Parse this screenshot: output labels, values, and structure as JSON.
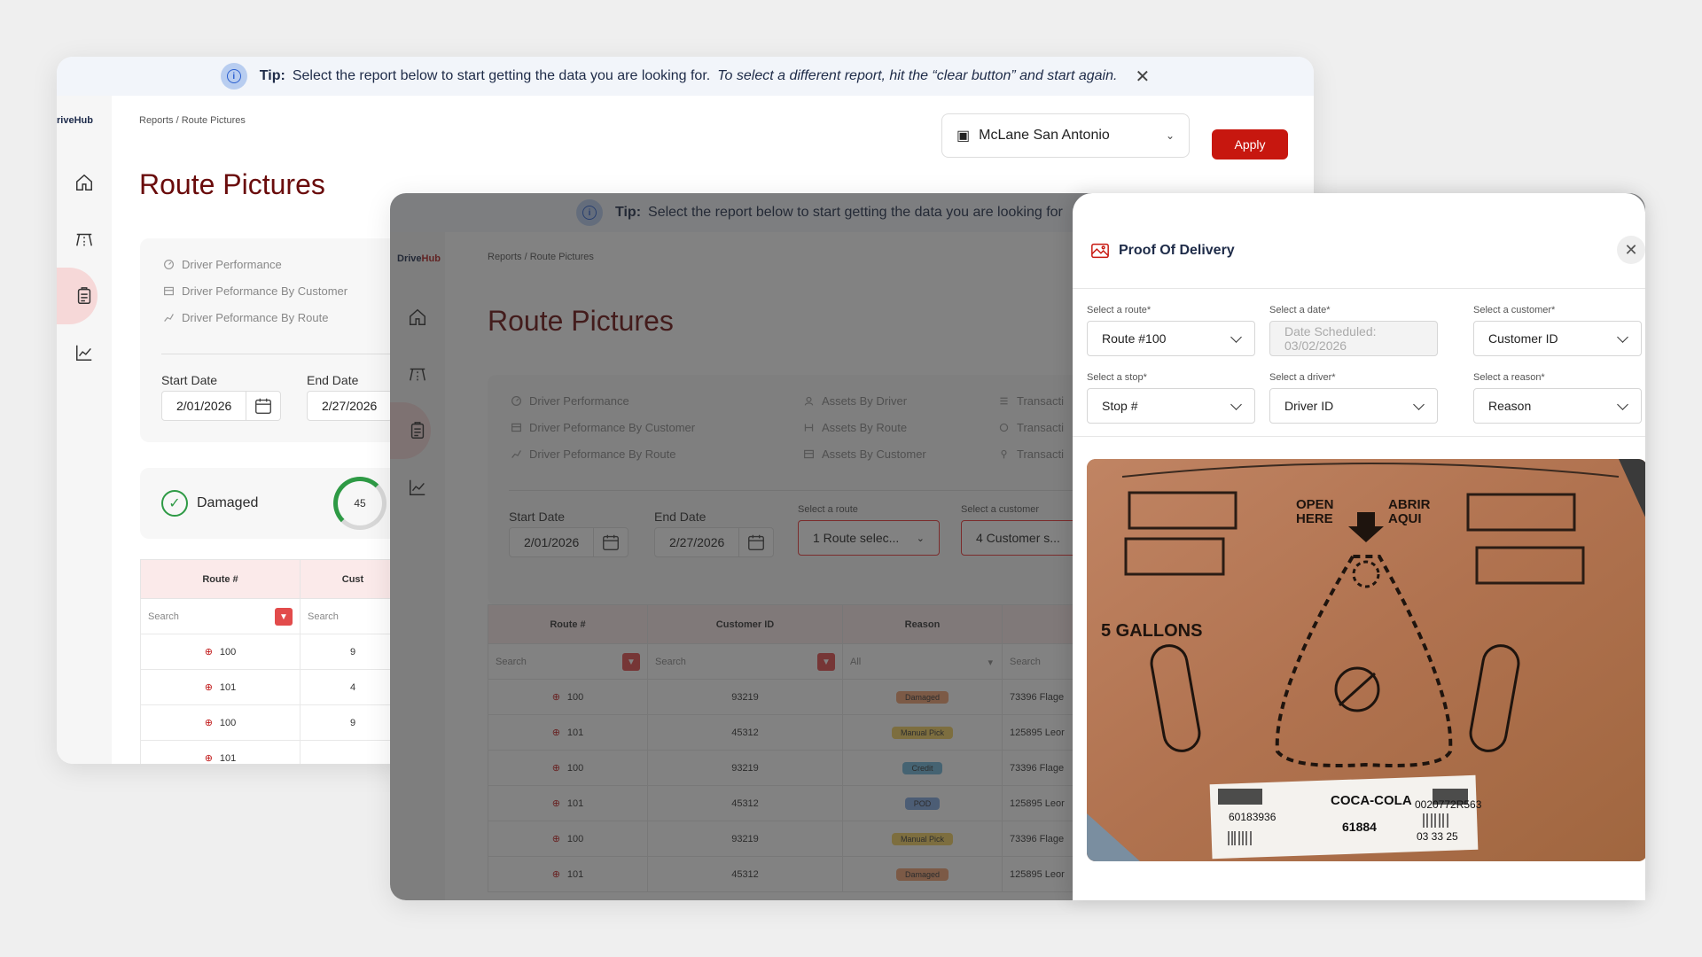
{
  "tip": {
    "label": "Tip:",
    "text": "Select the report below to start getting the data you are looking for.",
    "italic": "To select a different report, hit the “clear button” and start again."
  },
  "tip2_text": "Select the report below to start getting the data you are looking for",
  "logo_a": "Drive",
  "logo_b": "Hub",
  "logo_partial": "riveHub",
  "breadcrumb": {
    "root": "Reports",
    "sep": " / ",
    "current": "Route Pictures"
  },
  "page_title": "Route Pictures",
  "store": "McLane San Antonio",
  "apply_label": "Apply",
  "reports_col1": [
    "Driver Performance",
    "Driver Peformance By Customer",
    "Driver Peformance By Route"
  ],
  "reports_col2": [
    "Assets By Driver",
    "Assets By Route",
    "Assets By Customer"
  ],
  "reports_col3": [
    "Transacti",
    "Transacti",
    "Transacti"
  ],
  "start_date_label": "Start Date",
  "end_date_label": "End Date",
  "start_date": "2/01/2026",
  "end_date": "2/27/2026",
  "route_sel_label": "Select a route",
  "route_sel_value": "1 Route selec...",
  "cust_sel_label": "Select a customer",
  "cust_sel_value": "4 Customer s...",
  "damaged_label": "Damaged",
  "damaged_count": "45",
  "table1": {
    "headers": [
      "Route #",
      "Cust"
    ],
    "search": "Search",
    "rows": [
      [
        "100",
        "9"
      ],
      [
        "101",
        "4"
      ],
      [
        "100",
        "9"
      ],
      [
        "101",
        ""
      ]
    ]
  },
  "table2": {
    "headers": [
      "Route #",
      "Customer ID",
      "Reason",
      ""
    ],
    "search": "Search",
    "all": "All",
    "rows": [
      {
        "route": "100",
        "cust": "93219",
        "reason": "Damaged",
        "addr": "73396 Flage"
      },
      {
        "route": "101",
        "cust": "45312",
        "reason": "Manual Pick",
        "addr": "125895 Leor"
      },
      {
        "route": "100",
        "cust": "93219",
        "reason": "Credit",
        "addr": "73396 Flage"
      },
      {
        "route": "101",
        "cust": "45312",
        "reason": "POD",
        "addr": "125895 Leor"
      },
      {
        "route": "100",
        "cust": "93219",
        "reason": "Manual Pick",
        "addr": "73396 Flage"
      },
      {
        "route": "101",
        "cust": "45312",
        "reason": "Damaged",
        "addr": "125895 Leor"
      }
    ]
  },
  "reason_colors": {
    "Damaged": "#f0a070",
    "Manual Pick": "#f2d060",
    "Credit": "#6fb6d8",
    "POD": "#7ea6e0"
  },
  "modal": {
    "title": "Proof Of Delivery",
    "fields": [
      {
        "label": "Select a route*",
        "value": "Route #100"
      },
      {
        "label": "Select a date*",
        "value": "Date Scheduled: 03/02/2026"
      },
      {
        "label": "Select a customer*",
        "value": "Customer ID"
      },
      {
        "label": "Select a stop*",
        "value": "Stop #"
      },
      {
        "label": "Select a driver*",
        "value": "Driver ID"
      },
      {
        "label": "Select a reason*",
        "value": "Reason"
      }
    ]
  },
  "box": {
    "open1": "OPEN",
    "open2": "HERE",
    "abrir1": "ABRIR",
    "abrir2": "AQUI",
    "gallons": "5 GALLONS",
    "brand": "COCA-COLA",
    "code1": "60183936",
    "code2": "61884",
    "code3": "0020772R563",
    "code4": "03 33 25"
  },
  "accent": "#c7170f",
  "title_color": "#6a0c0c"
}
